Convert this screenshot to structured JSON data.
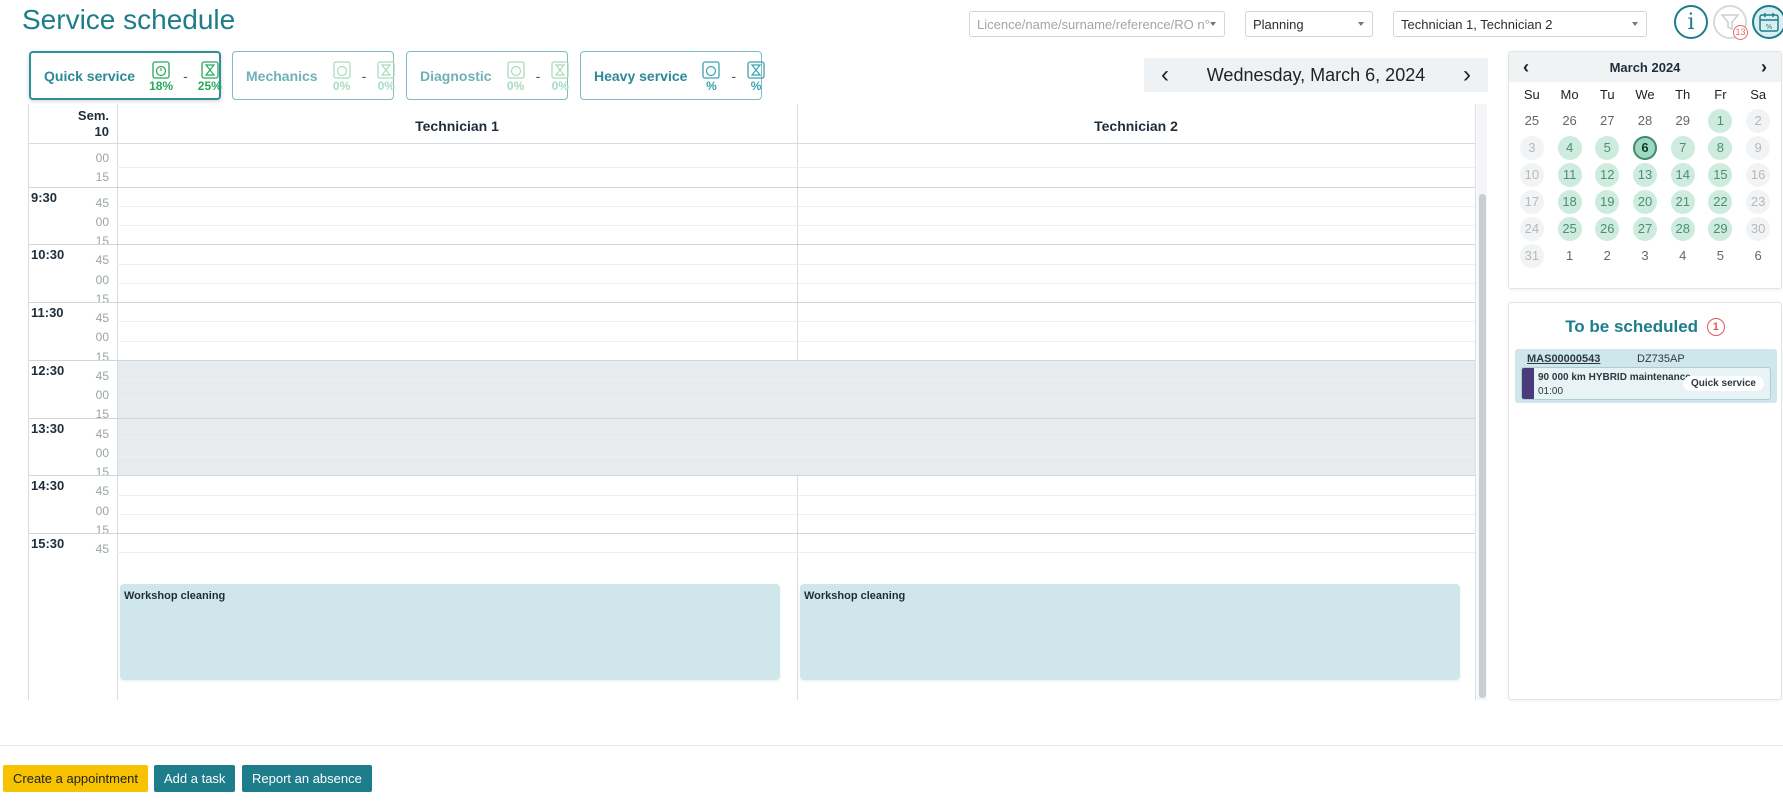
{
  "page": {
    "title": "Service schedule"
  },
  "filters": {
    "search_placeholder": "Licence/name/surname/reference/RO n°",
    "view": "Planning",
    "technicians": "Technician 1, Technician 2",
    "filter_badge": "13"
  },
  "categories": [
    {
      "label": "Quick service",
      "pct1": "18%",
      "pct2": "25%"
    },
    {
      "label": "Mechanics",
      "pct1": "0%",
      "pct2": "0%"
    },
    {
      "label": "Diagnostic",
      "pct1": "0%",
      "pct2": "0%"
    },
    {
      "label": "Heavy service",
      "pct1": "%",
      "pct2": "%"
    }
  ],
  "date_nav": {
    "date": "Wednesday, March 6, 2024",
    "prev": "‹",
    "next": "›"
  },
  "schedule": {
    "week_label": "Sem.",
    "week_number": "10",
    "columns": [
      "Technician 1",
      "Technician 2"
    ],
    "hour_labels": [
      "9:30",
      "10:30",
      "11:30",
      "12:30",
      "13:30",
      "14:30",
      "15:30"
    ],
    "minute_labels": [
      "45",
      "00",
      "15"
    ],
    "top_minutes": [
      "00",
      "15"
    ],
    "tasks": [
      {
        "title": "Workshop cleaning"
      },
      {
        "title": "Workshop cleaning"
      }
    ]
  },
  "mini_calendar": {
    "title": "March 2024",
    "prev": "‹",
    "next": "›",
    "weekdays": [
      "Su",
      "Mo",
      "Tu",
      "We",
      "Th",
      "Fr",
      "Sa"
    ],
    "days": [
      {
        "d": "25",
        "s": "other"
      },
      {
        "d": "26",
        "s": "other"
      },
      {
        "d": "27",
        "s": "other"
      },
      {
        "d": "28",
        "s": "other"
      },
      {
        "d": "29",
        "s": "other"
      },
      {
        "d": "1",
        "s": "avail"
      },
      {
        "d": "2",
        "s": "closed"
      },
      {
        "d": "3",
        "s": "closed"
      },
      {
        "d": "4",
        "s": "avail"
      },
      {
        "d": "5",
        "s": "avail"
      },
      {
        "d": "6",
        "s": "selected"
      },
      {
        "d": "7",
        "s": "avail"
      },
      {
        "d": "8",
        "s": "avail"
      },
      {
        "d": "9",
        "s": "closed"
      },
      {
        "d": "10",
        "s": "closed"
      },
      {
        "d": "11",
        "s": "avail"
      },
      {
        "d": "12",
        "s": "avail"
      },
      {
        "d": "13",
        "s": "avail"
      },
      {
        "d": "14",
        "s": "avail"
      },
      {
        "d": "15",
        "s": "avail"
      },
      {
        "d": "16",
        "s": "closed"
      },
      {
        "d": "17",
        "s": "closed"
      },
      {
        "d": "18",
        "s": "avail"
      },
      {
        "d": "19",
        "s": "avail"
      },
      {
        "d": "20",
        "s": "avail"
      },
      {
        "d": "21",
        "s": "avail"
      },
      {
        "d": "22",
        "s": "avail"
      },
      {
        "d": "23",
        "s": "closed"
      },
      {
        "d": "24",
        "s": "closed"
      },
      {
        "d": "25",
        "s": "avail"
      },
      {
        "d": "26",
        "s": "avail"
      },
      {
        "d": "27",
        "s": "avail"
      },
      {
        "d": "28",
        "s": "avail"
      },
      {
        "d": "29",
        "s": "avail"
      },
      {
        "d": "30",
        "s": "closed"
      },
      {
        "d": "31",
        "s": "closed"
      },
      {
        "d": "1",
        "s": "other"
      },
      {
        "d": "2",
        "s": "other"
      },
      {
        "d": "3",
        "s": "other"
      },
      {
        "d": "4",
        "s": "other"
      },
      {
        "d": "5",
        "s": "other"
      },
      {
        "d": "6",
        "s": "other"
      }
    ]
  },
  "to_be_scheduled": {
    "title": "To be scheduled",
    "count": "1",
    "item": {
      "reference": "MAS00000543",
      "plate": "DZ735AP",
      "job": "90 000 km HYBRID maintenance",
      "duration": "01:00",
      "tag": "Quick service"
    }
  },
  "actions": {
    "create_appointment": "Create a appointment",
    "add_task": "Add a task",
    "report_absence": "Report an absence"
  },
  "colors": {
    "accent": "#1d7d8a",
    "primary_button": "#f7c300",
    "task": "#cfe7ea",
    "available_day": "#cdebdf"
  },
  "icons": [
    "info-icon",
    "filter-icon",
    "calendar-percent-icon",
    "gauge-clock-icon",
    "hourglass-icon"
  ]
}
